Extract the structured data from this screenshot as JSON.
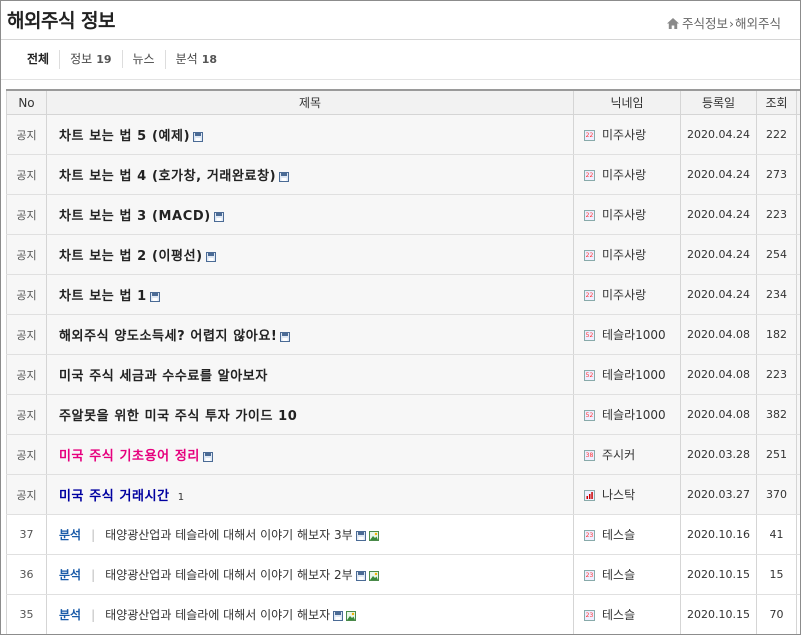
{
  "page": {
    "title": "해외주식 정보",
    "breadcrumb": [
      "주식정보",
      "해외주식"
    ]
  },
  "tabs": [
    {
      "label": "전체",
      "count": ""
    },
    {
      "label": "정보",
      "count": "19"
    },
    {
      "label": "뉴스",
      "count": ""
    },
    {
      "label": "분석",
      "count": "18"
    }
  ],
  "table": {
    "headers": {
      "no": "No",
      "subject": "제목",
      "nick": "닉네임",
      "date": "등록일",
      "hits": "조회"
    },
    "rows": [
      {
        "no": "공지",
        "subject": "차트 보는 법 5 (예제)",
        "nick": "미주사랑",
        "date": "2020.04.24",
        "hits": "222"
      },
      {
        "no": "공지",
        "subject": "차트 보는 법 4 (호가창, 거래완료창)",
        "nick": "미주사랑",
        "date": "2020.04.24",
        "hits": "273"
      },
      {
        "no": "공지",
        "subject": "차트 보는 법 3 (MACD)",
        "nick": "미주사랑",
        "date": "2020.04.24",
        "hits": "223"
      },
      {
        "no": "공지",
        "subject": "차트 보는 법 2 (이평선)",
        "nick": "미주사랑",
        "date": "2020.04.24",
        "hits": "254"
      },
      {
        "no": "공지",
        "subject": "차트 보는 법 1",
        "nick": "미주사랑",
        "date": "2020.04.24",
        "hits": "234"
      },
      {
        "no": "공지",
        "subject": "해외주식 양도소득세? 어렵지 않아요!",
        "nick": "테슬라1000",
        "date": "2020.04.08",
        "hits": "182"
      },
      {
        "no": "공지",
        "subject": "미국 주식 세금과 수수료를 알아보자",
        "nick": "테슬라1000",
        "date": "2020.04.08",
        "hits": "223"
      },
      {
        "no": "공지",
        "subject": "주알못을 위한 미국 주식 투자 가이드 10",
        "nick": "테슬라1000",
        "date": "2020.04.08",
        "hits": "382"
      },
      {
        "no": "공지",
        "subject": "미국 주식 기초용어 정리",
        "nick": "주시커",
        "date": "2020.03.28",
        "hits": "251"
      },
      {
        "no": "공지",
        "subject": "미국 주식 거래시간",
        "comments": "1",
        "nick": "나스탁",
        "date": "2020.03.27",
        "hits": "370"
      },
      {
        "no": "37",
        "category": "분석",
        "subject": "태양광산업과 테슬라에 대해서 이야기 해보자 3부",
        "nick": "테스슬",
        "date": "2020.10.16",
        "hits": "41"
      },
      {
        "no": "36",
        "category": "분석",
        "subject": "태양광산업과 테슬라에 대해서 이야기 해보자 2부",
        "nick": "테스슬",
        "date": "2020.10.15",
        "hits": "15"
      },
      {
        "no": "35",
        "category": "분석",
        "subject": "태양광산업과 테슬라에 대해서 이야기 해보자",
        "nick": "테스슬",
        "date": "2020.10.15",
        "hits": "70"
      }
    ]
  },
  "level_icons": [
    "22",
    "52",
    "38",
    "23"
  ],
  "colors": {
    "pink_title": "#e6007e",
    "navy_title": "#0000a0",
    "category": "#1a5ba8"
  }
}
